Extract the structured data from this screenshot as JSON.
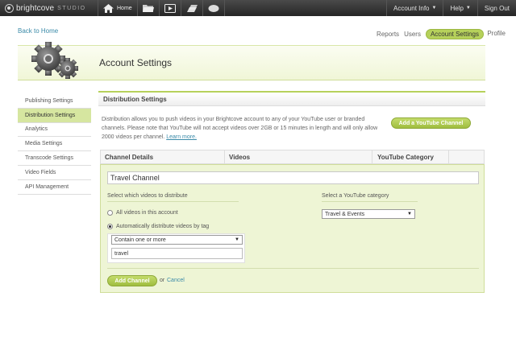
{
  "topbar": {
    "logo_text": "brightcove",
    "logo_sub": "STUDIO",
    "home_label": "Home",
    "account_info": "Account Info",
    "help": "Help",
    "sign_out": "Sign Out"
  },
  "subnav": {
    "back": "Back to Home",
    "tabs": [
      {
        "label": "Reports"
      },
      {
        "label": "Users"
      },
      {
        "label": "Account Settings"
      }
    ],
    "profile": "Profile"
  },
  "banner": {
    "title": "Account Settings"
  },
  "sidebar": {
    "items": [
      {
        "label": "Publishing Settings"
      },
      {
        "label": "Distribution Settings"
      },
      {
        "label": "Analytics"
      },
      {
        "label": "Media Settings"
      },
      {
        "label": "Transcode Settings"
      },
      {
        "label": "Video Fields"
      },
      {
        "label": "API Management"
      }
    ]
  },
  "main": {
    "section_title": "Distribution Settings",
    "description": "Distribution allows you to push videos in your Brightcove account to any of your YouTube user or branded channels. Please note that YouTube will not accept videos over 2GB or 15 minutes in length and will only allow 2000 videos per channel.",
    "learn_more": "Learn more.",
    "add_youtube_channel": "Add a YouTube Channel",
    "columns": [
      "Channel Details",
      "Videos",
      "YouTube Category",
      ""
    ],
    "channel_name": "Travel Channel",
    "videos_label": "Select which videos to distribute",
    "option_all": "All videos in this account",
    "option_tag": "Automatically distribute videos by tag",
    "tag_match_value": "Contain one or more",
    "tag_value": "travel",
    "category_label": "Select a YouTube category",
    "category_value": "Travel & Events",
    "add_channel": "Add Channel",
    "or": "or",
    "cancel": "Cancel"
  },
  "colors": {
    "accent": "#b6d15b",
    "link": "#3a8aa8",
    "topbar": "#333333"
  }
}
